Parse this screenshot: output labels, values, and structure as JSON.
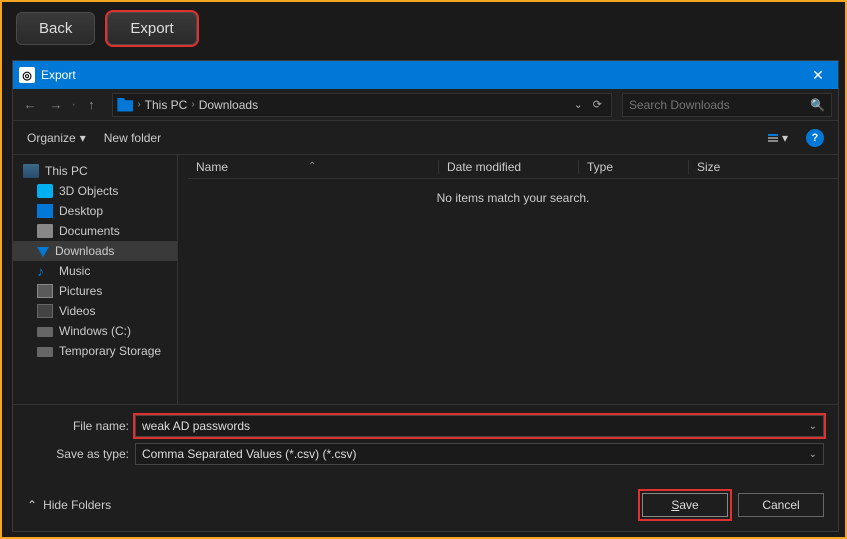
{
  "top": {
    "back": "Back",
    "export": "Export"
  },
  "dialog": {
    "title": "Export",
    "breadcrumb": {
      "root": "This PC",
      "current": "Downloads"
    },
    "search_placeholder": "Search Downloads",
    "toolbar": {
      "organize": "Organize",
      "newfolder": "New folder"
    },
    "tree": {
      "root": "This PC",
      "items": [
        "3D Objects",
        "Desktop",
        "Documents",
        "Downloads",
        "Music",
        "Pictures",
        "Videos",
        "Windows (C:)",
        "Temporary Storage"
      ]
    },
    "columns": {
      "name": "Name",
      "date": "Date modified",
      "type": "Type",
      "size": "Size"
    },
    "empty_msg": "No items match your search.",
    "filename_label": "File name:",
    "filename_value": "weak AD passwords",
    "filetype_label": "Save as type:",
    "filetype_value": "Comma Separated Values (*.csv) (*.csv)",
    "hide_folders": "Hide Folders",
    "save": "Save",
    "cancel": "Cancel"
  }
}
